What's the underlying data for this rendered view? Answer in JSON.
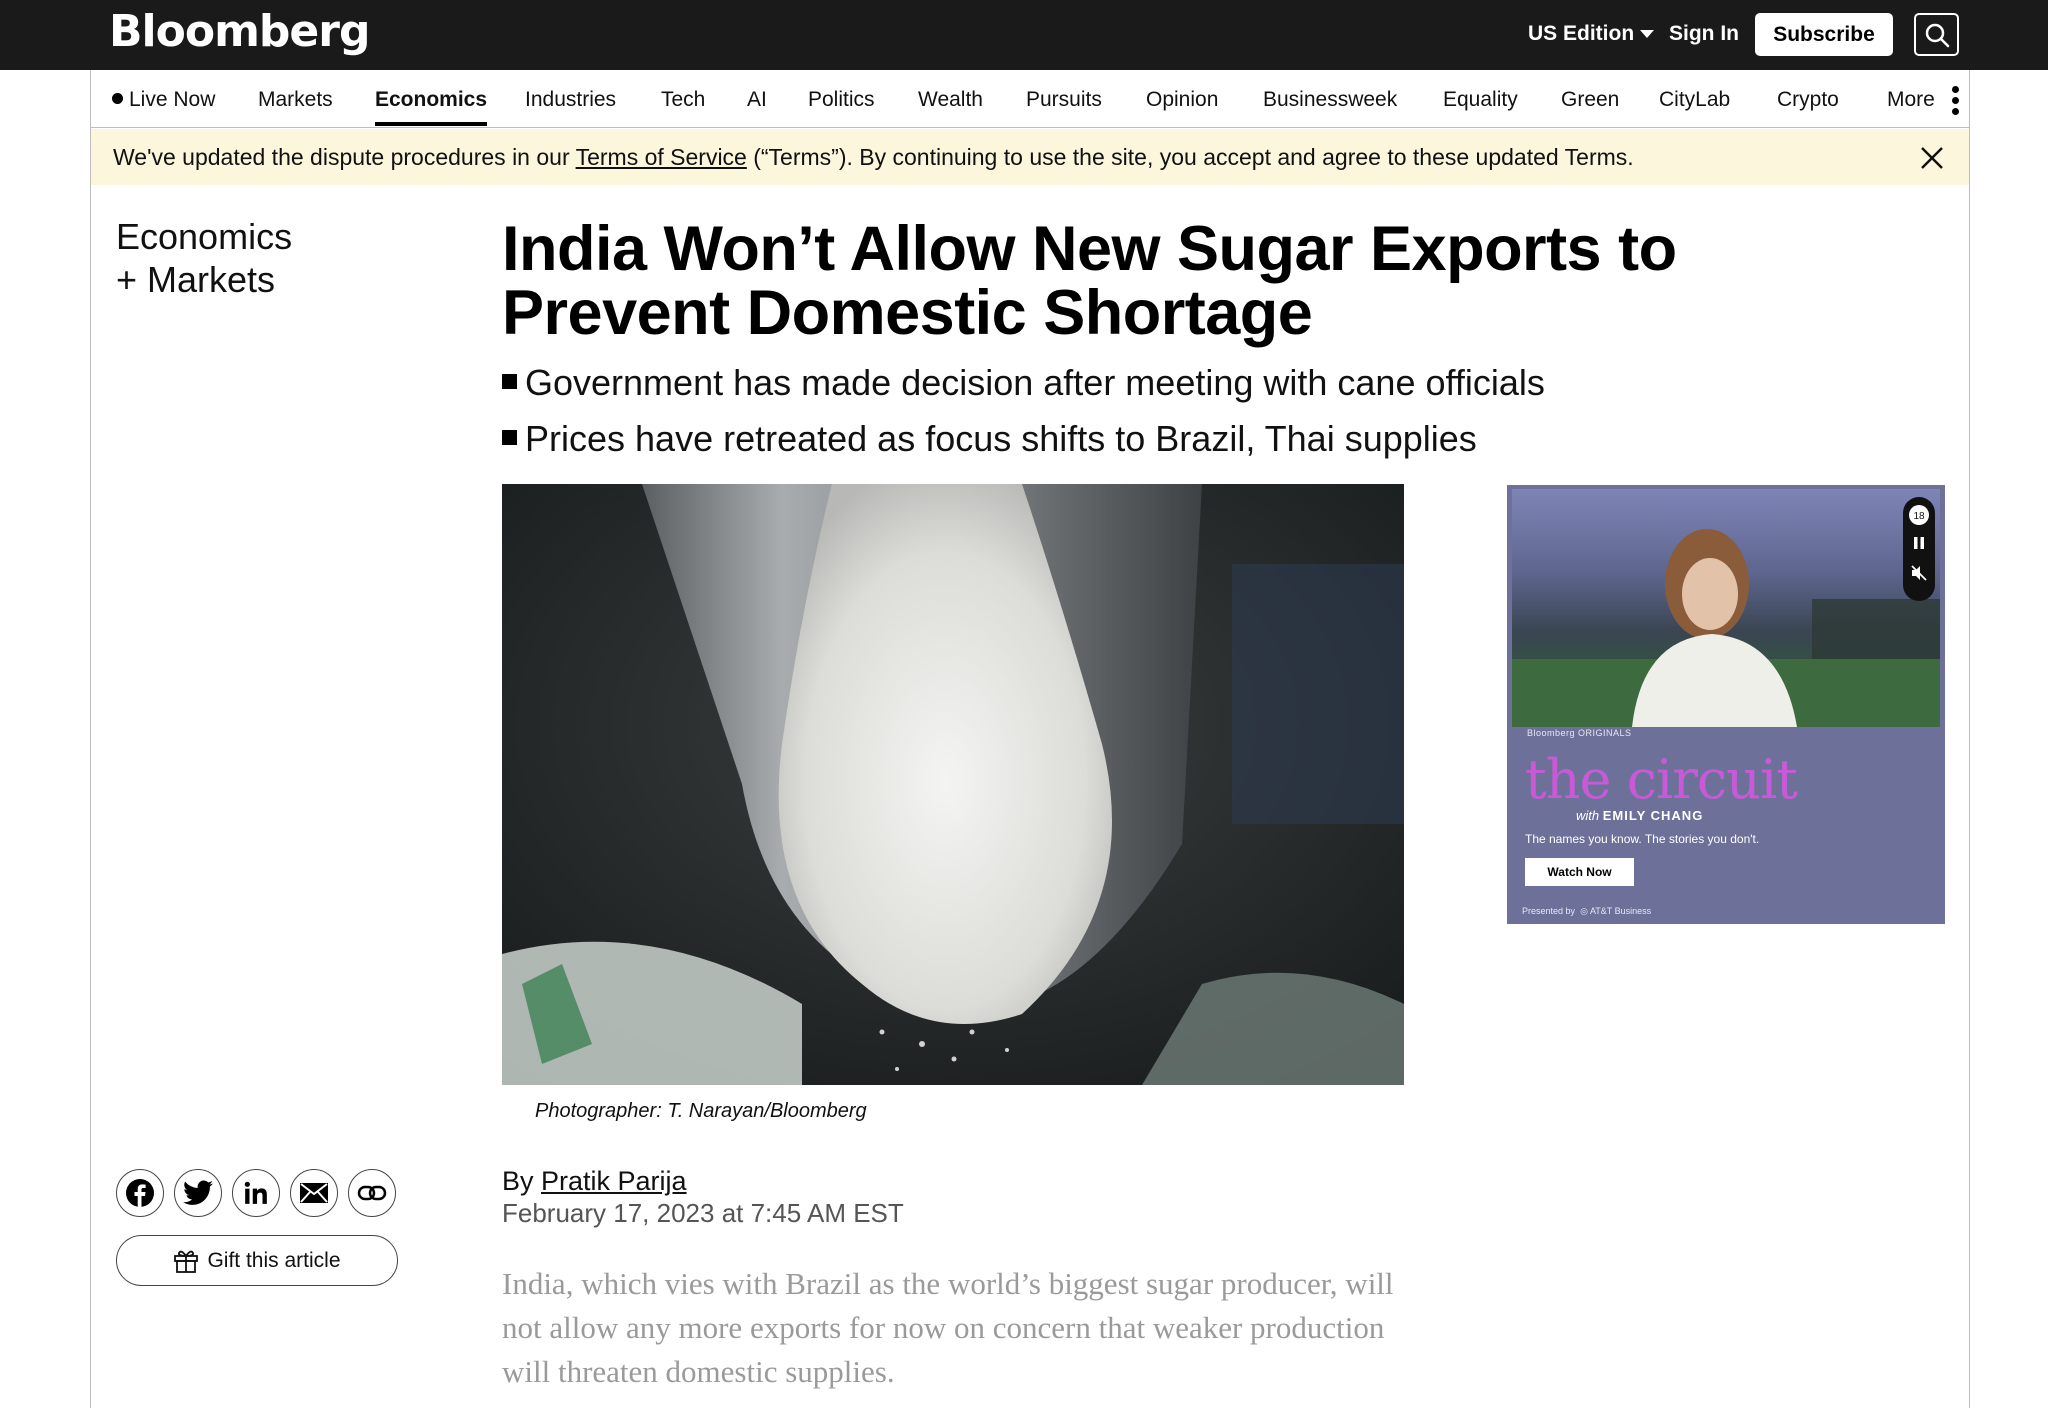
{
  "header": {
    "logo": "Bloomberg",
    "edition_label": "US Edition",
    "signin_label": "Sign In",
    "subscribe_label": "Subscribe",
    "search_icon": "search-icon"
  },
  "nav": {
    "live_label": "Live Now",
    "items": [
      "Markets",
      "Economics",
      "Industries",
      "Tech",
      "AI",
      "Politics",
      "Wealth",
      "Pursuits",
      "Opinion",
      "Businessweek",
      "Equality",
      "Green",
      "CityLab",
      "Crypto",
      "More"
    ],
    "active": "Economics"
  },
  "notice": {
    "before": "We've updated the dispute procedures in our ",
    "link": "Terms of Service",
    "after": " (“Terms”). By continuing to use the site, you accept and agree to these updated Terms."
  },
  "section": {
    "line1": "Economics",
    "line2": "+ Markets"
  },
  "article": {
    "headline": "India Won’t Allow New Sugar Exports to Prevent Domestic Shortage",
    "bullets": [
      "Government has made decision after meeting with cane officials",
      "Prices have retreated as focus shifts to Brazil, Thai supplies"
    ],
    "caption": "Photographer: T. Narayan/Bloomberg",
    "by_prefix": "By ",
    "author": "Pratik Parija",
    "date": "February 17, 2023 at 7:45 AM EST",
    "lede": "India, which vies with Brazil as the world’s biggest sugar producer, will not allow any more exports for now on concern that weaker production will threaten domestic supplies."
  },
  "share": {
    "icons": [
      "facebook-icon",
      "twitter-icon",
      "linkedin-icon",
      "email-icon",
      "link-icon"
    ],
    "gift_label": "Gift this article"
  },
  "ad": {
    "brand": "Bloomberg ORIGINALS",
    "title": "the circuit",
    "with_prefix": "with ",
    "with_name": "EMILY CHANG",
    "tagline": "The names you know. The stories you don't.",
    "cta": "Watch Now",
    "presented": "Presented by",
    "sponsor": "AT&T Business",
    "timer": "18"
  },
  "colors": {
    "topbar": "#1a1a1a",
    "notice_bg": "#fbf6dc",
    "ad_bg": "#6d7199",
    "ad_title": "#c85ad8"
  }
}
